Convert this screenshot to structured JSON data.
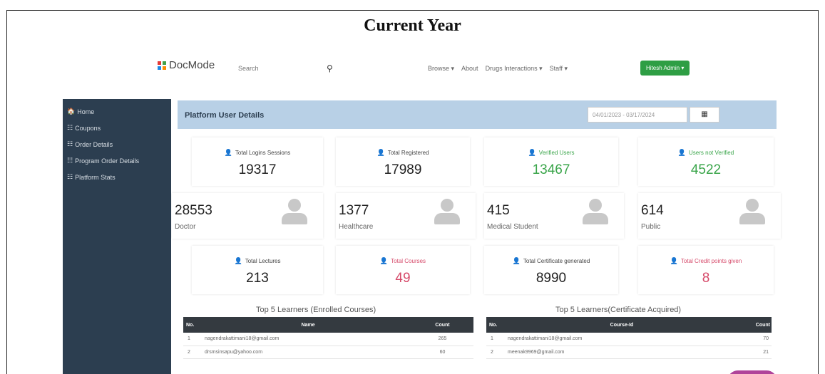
{
  "caption": "Current Year",
  "logo": {
    "text": "DocMode",
    "colors": [
      "#e53935",
      "#43a047",
      "#1e88e5",
      "#fb8c00"
    ]
  },
  "search": {
    "placeholder": "Search",
    "icon": "search-icon"
  },
  "nav": [
    "Browse ▾",
    "About",
    "Drugs Interactions ▾",
    "Staff ▾"
  ],
  "user_button": "Hitesh Admin ▾",
  "sidebar": [
    {
      "icon": "home-icon",
      "glyph": "🏠",
      "label": "Home"
    },
    {
      "icon": "list-icon",
      "glyph": "☷",
      "label": "Coupons"
    },
    {
      "icon": "list-icon",
      "glyph": "☷",
      "label": "Order Details"
    },
    {
      "icon": "list-icon",
      "glyph": "☷",
      "label": "Program Order Details"
    },
    {
      "icon": "list-icon",
      "glyph": "☷",
      "label": "Platform Stats"
    }
  ],
  "panel": {
    "title": "Platform User Details",
    "date_range": "04/01/2023 - 03/17/2024",
    "calendar_icon": "▦"
  },
  "stats_row1": [
    {
      "label": "Total Logins Sessions",
      "value": "19317",
      "tone": ""
    },
    {
      "label": "Total Registered",
      "value": "17989",
      "tone": ""
    },
    {
      "label": "Verified Users",
      "value": "13467",
      "tone": "green"
    },
    {
      "label": "Users not Verified",
      "value": "4522",
      "tone": "green"
    }
  ],
  "profiles": [
    {
      "value": "28553",
      "name": "Doctor"
    },
    {
      "value": "1377",
      "name": "Healthcare"
    },
    {
      "value": "415",
      "name": "Medical Student"
    },
    {
      "value": "614",
      "name": "Public"
    }
  ],
  "stats_row3": [
    {
      "label": "Total Lectures",
      "value": "213",
      "tone": ""
    },
    {
      "label": "Total Courses",
      "value": "49",
      "tone": "red"
    },
    {
      "label": "Total Certificate generated",
      "value": "8990",
      "tone": ""
    },
    {
      "label": "Total Credit points given",
      "value": "8",
      "tone": "red"
    }
  ],
  "table_left": {
    "title": "Top 5 Learners (Enrolled Courses)",
    "headers": [
      "No.",
      "Name",
      "Count"
    ],
    "rows": [
      [
        "1",
        "nagendrakattimani18@gmail.com",
        "265"
      ],
      [
        "2",
        "drsmsinsapu@yahoo.com",
        "60"
      ]
    ]
  },
  "table_right": {
    "title": "Top 5 Learners(Certificate Acquired)",
    "headers": [
      "No.",
      "Course-Id",
      "Count"
    ],
    "rows": [
      [
        "1",
        "nagendrakattimani18@gmail.com",
        "70"
      ],
      [
        "2",
        "meenak9969@gmail.com",
        "21"
      ]
    ]
  }
}
